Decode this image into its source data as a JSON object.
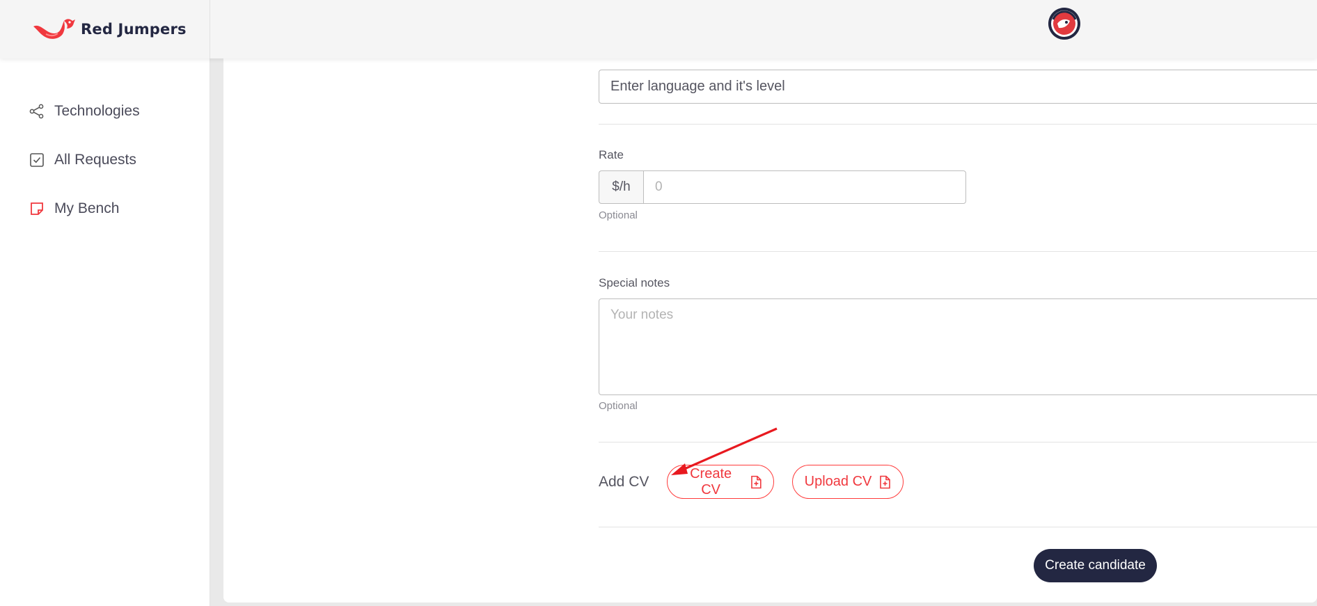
{
  "brand": {
    "name": "Red Jumpers"
  },
  "header": {
    "avatar_icon": "team-badge-avatar"
  },
  "sidebar": {
    "items": [
      {
        "label": "Technologies",
        "icon": "share-nodes-icon"
      },
      {
        "label": "All Requests",
        "icon": "checkbox-icon"
      },
      {
        "label": "My Bench",
        "icon": "sticky-note-icon"
      }
    ]
  },
  "form": {
    "language": {
      "placeholder": "Enter language and it's level"
    },
    "rate": {
      "label": "Rate",
      "prefix": "$/h",
      "placeholder": "0",
      "hint": "Optional"
    },
    "notes": {
      "label": "Special notes",
      "placeholder": "Your notes",
      "hint": "Optional"
    },
    "cv": {
      "label": "Add CV",
      "create_label": "Create CV",
      "upload_label": "Upload CV"
    },
    "submit_label": "Create candidate"
  },
  "colors": {
    "accent": "#f0383e",
    "navy": "#232742"
  }
}
